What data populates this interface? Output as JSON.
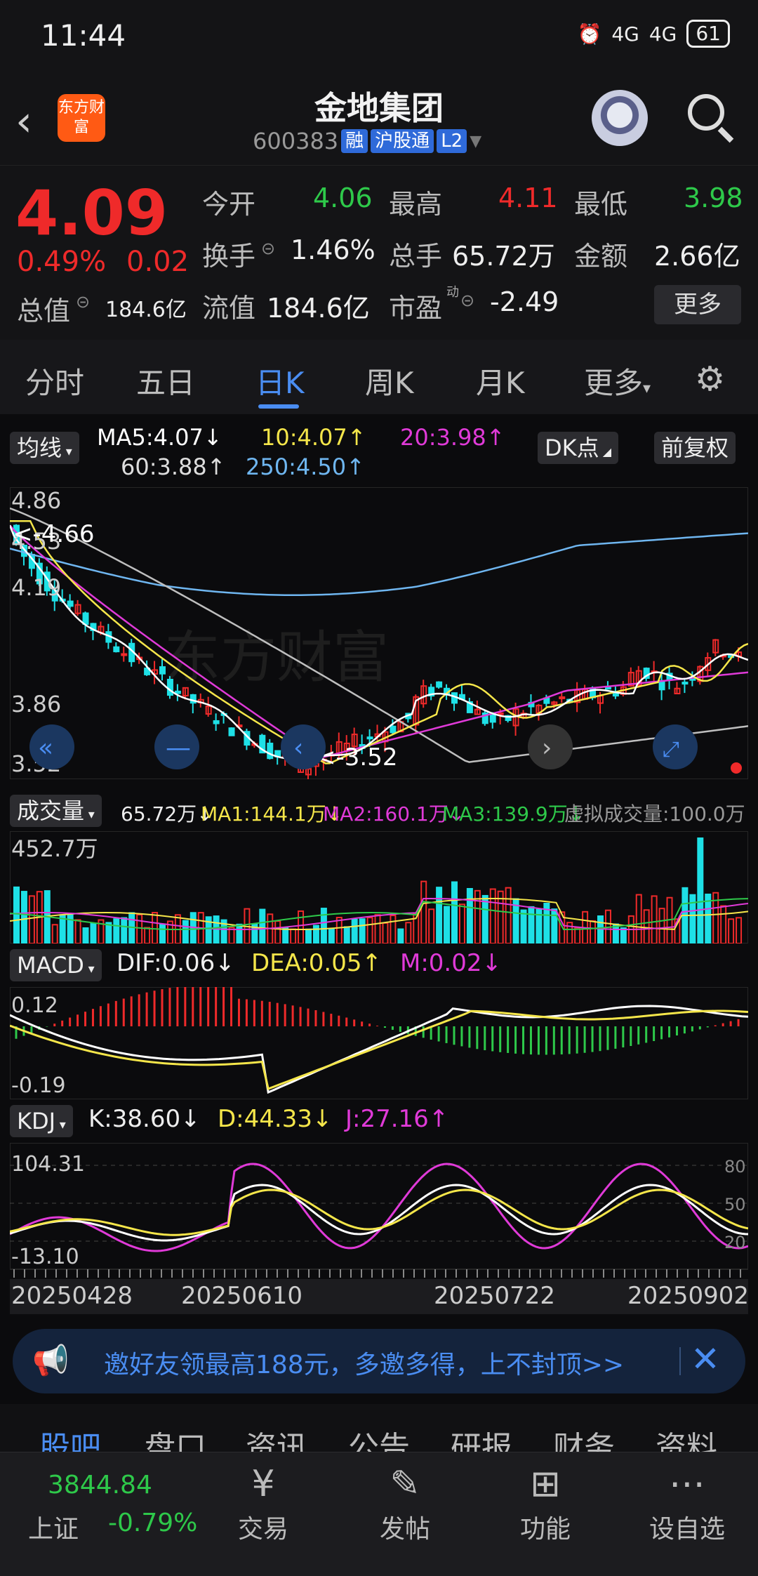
{
  "status_bar": {
    "time": "11:44",
    "signal1": "4G",
    "signal2": "4G",
    "battery": "61"
  },
  "header": {
    "logo": "东方财富",
    "title": "金地集团",
    "code": "600383",
    "tags": [
      "融",
      "沪股通",
      "L2"
    ]
  },
  "quote": {
    "price": "4.09",
    "pct": "0.49%",
    "change": "0.02",
    "open_label": "今开",
    "open": "4.06",
    "high_label": "最高",
    "high": "4.11",
    "low_label": "最低",
    "low": "3.98",
    "turnover_label": "换手",
    "turnover": "1.46%",
    "volume_label": "总手",
    "volume": "65.72万",
    "amount_label": "金额",
    "amount": "2.66亿",
    "mktcap_label": "总值",
    "mktcap": "184.6亿",
    "float_label": "流值",
    "float": "184.6亿",
    "pe_label": "市盈",
    "pe_sup": "动",
    "pe": "-2.49",
    "more": "更多"
  },
  "tabs": [
    "分时",
    "五日",
    "日K",
    "周K",
    "月K",
    "更多"
  ],
  "active_tab": "日K",
  "ma": {
    "selector": "均线",
    "ma5": "MA5:4.07↓",
    "ma10": "10:4.07↑",
    "ma20": "20:3.98↑",
    "ma60": "60:3.88↑",
    "ma250": "250:4.50↑",
    "dk": "DK点",
    "adjust": "前复权"
  },
  "kline": {
    "y_labels": [
      "4.86",
      "4.53",
      "4.19",
      "3.86",
      "3.52"
    ],
    "high_mark": "<-4.66",
    "low_mark": "<-3.52"
  },
  "volume": {
    "selector": "成交量",
    "vol": "65.72万↓",
    "ma1": "MA1:144.1万↓",
    "ma2": "MA2:160.1万↓",
    "ma3": "MA3:139.9万↓",
    "virtual": "虚拟成交量:100.0万",
    "max_label": "452.7万"
  },
  "macd": {
    "selector": "MACD",
    "dif": "DIF:0.06↓",
    "dea": "DEA:0.05↑",
    "m": "M:0.02↓",
    "top": "0.12",
    "bottom": "-0.19"
  },
  "kdj": {
    "selector": "KDJ",
    "k": "K:38.60↓",
    "d": "D:44.33↓",
    "j": "J:27.16↑",
    "top": "104.31",
    "bottom": "-13.10",
    "lines": [
      "80",
      "50",
      "20"
    ]
  },
  "dates": [
    "20250428",
    "20250610",
    "20250722",
    "20250902"
  ],
  "banner": {
    "text": "邀好友领最高188元，多邀多得，上不封顶>>"
  },
  "bottom_tabs": [
    "股吧",
    "盘口",
    "资讯",
    "公告",
    "研报",
    "财务",
    "资料"
  ],
  "bottom_nav": {
    "index_value": "3844.84",
    "index_name": "上证",
    "index_pct": "-0.79%",
    "items": [
      "交易",
      "发帖",
      "功能",
      "设自选"
    ]
  },
  "colors": {
    "up": "#ef2a2a",
    "down": "#2ec94a",
    "accent": "#4a8df2",
    "ma5": "#ffffff",
    "ma10": "#f5e64a",
    "ma20": "#e03ad8",
    "ma60": "#bfbfbf",
    "ma250": "#6fb6f0"
  }
}
